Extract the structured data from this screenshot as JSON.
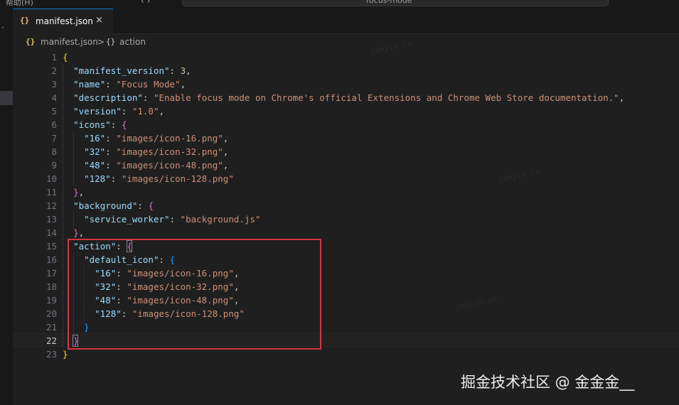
{
  "titlebar": {
    "menu": "帮助(H)",
    "nav": "‹ ›",
    "search_text": "focus-mode"
  },
  "tab": {
    "icon": "{}",
    "label": "manifest.json",
    "close": "×"
  },
  "breadcrumb": {
    "icon_file": "{}",
    "file": "manifest.json",
    "separator": ">",
    "icon_symbol": "{}",
    "symbol": "action"
  },
  "editor": {
    "active_line": 22,
    "lines": [
      {
        "n": "1",
        "tokens": [
          {
            "t": "{",
            "c": "b1"
          }
        ]
      },
      {
        "n": "2",
        "tokens": [
          {
            "t": "  "
          },
          {
            "t": "\"manifest_version\"",
            "c": "k"
          },
          {
            "t": ": "
          },
          {
            "t": "3",
            "c": "n"
          },
          {
            "t": ","
          }
        ]
      },
      {
        "n": "3",
        "tokens": [
          {
            "t": "  "
          },
          {
            "t": "\"name\"",
            "c": "k"
          },
          {
            "t": ": "
          },
          {
            "t": "\"Focus Mode\"",
            "c": "s"
          },
          {
            "t": ","
          }
        ]
      },
      {
        "n": "4",
        "tokens": [
          {
            "t": "  "
          },
          {
            "t": "\"description\"",
            "c": "k"
          },
          {
            "t": ": "
          },
          {
            "t": "\"Enable focus mode on Chrome's official Extensions and Chrome Web Store documentation.\"",
            "c": "s"
          },
          {
            "t": ","
          }
        ]
      },
      {
        "n": "5",
        "tokens": [
          {
            "t": "  "
          },
          {
            "t": "\"version\"",
            "c": "k"
          },
          {
            "t": ": "
          },
          {
            "t": "\"1.0\"",
            "c": "s"
          },
          {
            "t": ","
          }
        ]
      },
      {
        "n": "6",
        "tokens": [
          {
            "t": "  "
          },
          {
            "t": "\"icons\"",
            "c": "k"
          },
          {
            "t": ": "
          },
          {
            "t": "{",
            "c": "b2"
          }
        ]
      },
      {
        "n": "7",
        "tokens": [
          {
            "t": "    "
          },
          {
            "t": "\"16\"",
            "c": "k"
          },
          {
            "t": ": "
          },
          {
            "t": "\"images/icon-16.png\"",
            "c": "s"
          },
          {
            "t": ","
          }
        ]
      },
      {
        "n": "8",
        "tokens": [
          {
            "t": "    "
          },
          {
            "t": "\"32\"",
            "c": "k"
          },
          {
            "t": ": "
          },
          {
            "t": "\"images/icon-32.png\"",
            "c": "s"
          },
          {
            "t": ","
          }
        ]
      },
      {
        "n": "9",
        "tokens": [
          {
            "t": "    "
          },
          {
            "t": "\"48\"",
            "c": "k"
          },
          {
            "t": ": "
          },
          {
            "t": "\"images/icon-48.png\"",
            "c": "s"
          },
          {
            "t": ","
          }
        ]
      },
      {
        "n": "10",
        "tokens": [
          {
            "t": "    "
          },
          {
            "t": "\"128\"",
            "c": "k"
          },
          {
            "t": ": "
          },
          {
            "t": "\"images/icon-128.png\"",
            "c": "s"
          }
        ]
      },
      {
        "n": "11",
        "tokens": [
          {
            "t": "  "
          },
          {
            "t": "}",
            "c": "b2"
          },
          {
            "t": ","
          }
        ]
      },
      {
        "n": "12",
        "tokens": [
          {
            "t": "  "
          },
          {
            "t": "\"background\"",
            "c": "k"
          },
          {
            "t": ": "
          },
          {
            "t": "{",
            "c": "b2"
          }
        ]
      },
      {
        "n": "13",
        "tokens": [
          {
            "t": "    "
          },
          {
            "t": "\"service_worker\"",
            "c": "k"
          },
          {
            "t": ": "
          },
          {
            "t": "\"background.js\"",
            "c": "s"
          }
        ]
      },
      {
        "n": "14",
        "tokens": [
          {
            "t": "  "
          },
          {
            "t": "}",
            "c": "b2"
          },
          {
            "t": ","
          }
        ]
      },
      {
        "n": "15",
        "tokens": [
          {
            "t": "  "
          },
          {
            "t": "\"action\"",
            "c": "k"
          },
          {
            "t": ": "
          },
          {
            "t": "{",
            "c": "b2"
          }
        ]
      },
      {
        "n": "16",
        "tokens": [
          {
            "t": "    "
          },
          {
            "t": "\"default_icon\"",
            "c": "k"
          },
          {
            "t": ": "
          },
          {
            "t": "{",
            "c": "b3"
          }
        ]
      },
      {
        "n": "17",
        "tokens": [
          {
            "t": "      "
          },
          {
            "t": "\"16\"",
            "c": "k"
          },
          {
            "t": ": "
          },
          {
            "t": "\"images/icon-16.png\"",
            "c": "s"
          },
          {
            "t": ","
          }
        ]
      },
      {
        "n": "18",
        "tokens": [
          {
            "t": "      "
          },
          {
            "t": "\"32\"",
            "c": "k"
          },
          {
            "t": ": "
          },
          {
            "t": "\"images/icon-32.png\"",
            "c": "s"
          },
          {
            "t": ","
          }
        ]
      },
      {
        "n": "19",
        "tokens": [
          {
            "t": "      "
          },
          {
            "t": "\"48\"",
            "c": "k"
          },
          {
            "t": ": "
          },
          {
            "t": "\"images/icon-48.png\"",
            "c": "s"
          },
          {
            "t": ","
          }
        ]
      },
      {
        "n": "20",
        "tokens": [
          {
            "t": "      "
          },
          {
            "t": "\"128\"",
            "c": "k"
          },
          {
            "t": ": "
          },
          {
            "t": "\"images/icon-128.png\"",
            "c": "s"
          }
        ]
      },
      {
        "n": "21",
        "tokens": [
          {
            "t": "    "
          },
          {
            "t": "}",
            "c": "b3"
          }
        ]
      },
      {
        "n": "22",
        "tokens": [
          {
            "t": "  "
          },
          {
            "t": "}",
            "c": "b2"
          }
        ]
      },
      {
        "n": "23",
        "tokens": [
          {
            "t": "}",
            "c": "b1"
          }
        ]
      }
    ]
  },
  "watermark": "掘金技术社区 @ 金金金__",
  "colors": {
    "key": "#9cdcfe",
    "string": "#ce9178",
    "number": "#b5cea8",
    "bracket_gold": "#ffd700",
    "bracket_purple": "#da70d6",
    "bracket_blue": "#179fff",
    "highlight_box": "#d43545",
    "tab_accent": "#0078d4"
  }
}
